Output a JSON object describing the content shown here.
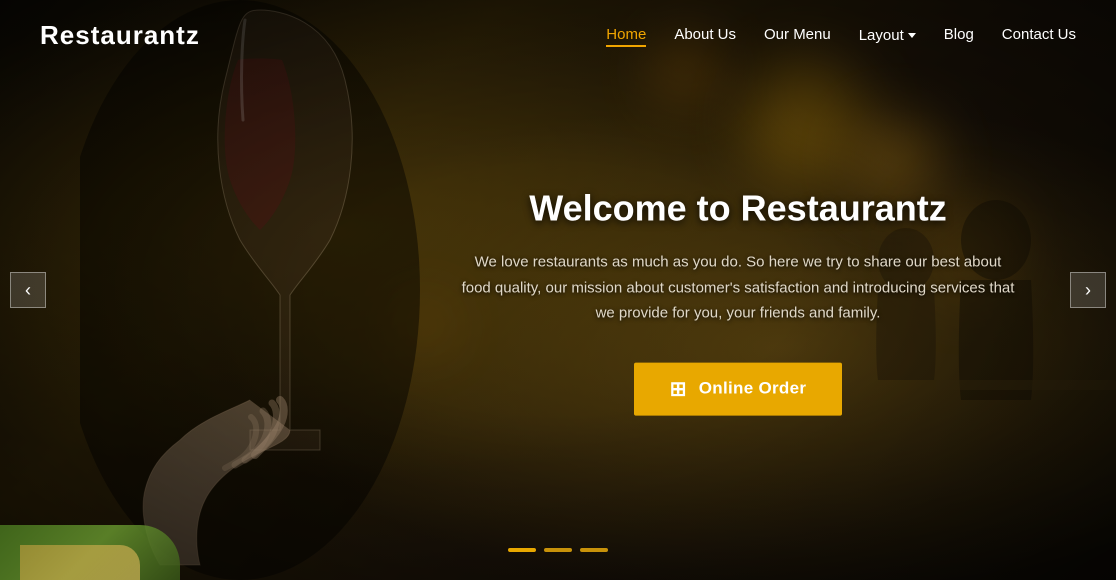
{
  "brand": {
    "name": "Restaurantz"
  },
  "nav": {
    "links": [
      {
        "label": "Home",
        "active": true,
        "hasDropdown": false
      },
      {
        "label": "About Us",
        "active": false,
        "hasDropdown": false
      },
      {
        "label": "Our Menu",
        "active": false,
        "hasDropdown": false
      },
      {
        "label": "Layout",
        "active": false,
        "hasDropdown": true
      },
      {
        "label": "Blog",
        "active": false,
        "hasDropdown": false
      },
      {
        "label": "Contact Us",
        "active": false,
        "hasDropdown": false
      }
    ]
  },
  "hero": {
    "title": "Welcome to Restaurantz",
    "subtitle": "We love restaurants as much as you do. So here we try to share our best about food quality, our mission about customer's satisfaction and introducing services that we provide for you, your friends and family.",
    "cta_label": "Online Order"
  },
  "arrows": {
    "left": "‹",
    "right": "›"
  },
  "colors": {
    "accent": "#e8a800",
    "nav_active": "#f0a500"
  }
}
